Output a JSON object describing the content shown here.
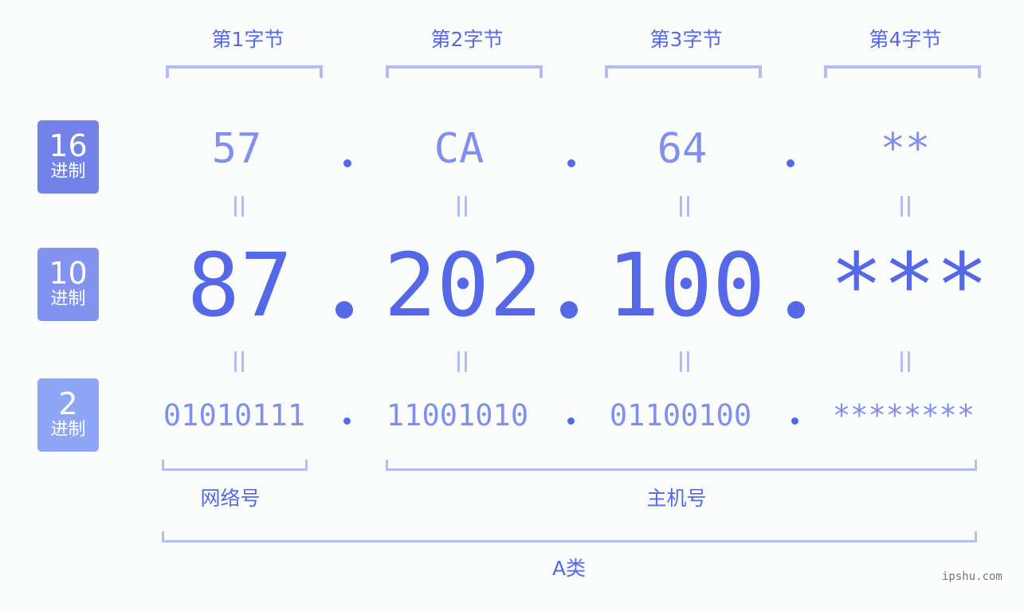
{
  "bytes": [
    {
      "title": "第1字节",
      "hex": "57",
      "dec": "87",
      "bin": "01010111"
    },
    {
      "title": "第2字节",
      "hex": "CA",
      "dec": "202",
      "bin": "11001010"
    },
    {
      "title": "第3字节",
      "hex": "64",
      "dec": "100",
      "bin": "01100100"
    },
    {
      "title": "第4字节",
      "hex": "**",
      "dec": "***",
      "bin": "********"
    }
  ],
  "bases": [
    {
      "num": "16",
      "label": "进制",
      "color": "#7383ea"
    },
    {
      "num": "10",
      "label": "进制",
      "color": "#8393f0"
    },
    {
      "num": "2",
      "label": "进制",
      "color": "#8fa6f7"
    }
  ],
  "sections": {
    "network": "网络号",
    "host": "主机号",
    "class": "A类"
  },
  "separator": ".",
  "equals": "=",
  "watermark": "ipshu.com",
  "colors": {
    "primary": "#5468e8",
    "secondary": "#8090ef",
    "bracket": "#b3bdf6"
  }
}
